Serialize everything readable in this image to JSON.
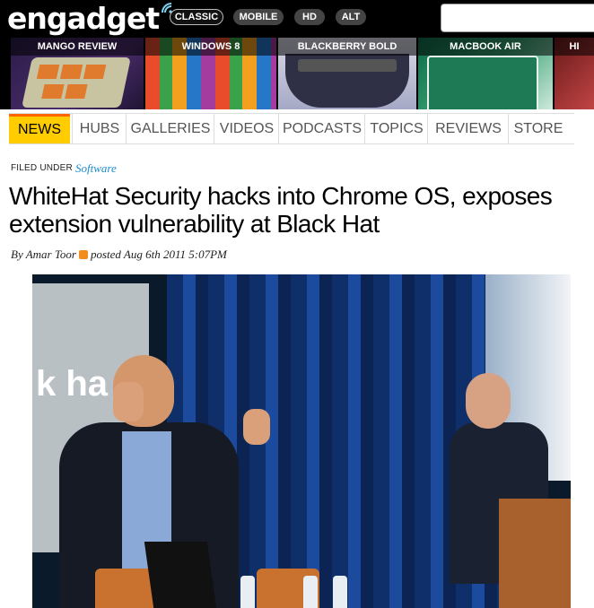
{
  "header": {
    "logo": "engadget",
    "editions": [
      "CLASSIC",
      "MOBILE",
      "HD",
      "ALT"
    ],
    "search_placeholder": ""
  },
  "features": [
    {
      "label": "MANGO REVIEW"
    },
    {
      "label": "WINDOWS 8"
    },
    {
      "label": "BLACKBERRY BOLD"
    },
    {
      "label": "MACBOOK AIR"
    },
    {
      "label": "HI"
    }
  ],
  "nav": [
    "NEWS",
    "HUBS",
    "GALLERIES",
    "VIDEOS",
    "PODCASTS",
    "TOPICS",
    "REVIEWS",
    "STORE"
  ],
  "active_nav": "NEWS",
  "article": {
    "filed_under": "FILED UNDER",
    "category": "Software",
    "headline": "WhiteHat Security hacks into Chrome OS, exposes extension vulnerability at Black Hat",
    "byline_author": "By Amar Toor",
    "byline_posted": "posted Aug 6th 2011 5:07PM",
    "banner_text": "k ha"
  },
  "colors": {
    "accent_yellow": "#ffcc00",
    "accent_orange": "#ff6600",
    "link_blue": "#1a8ccc"
  }
}
